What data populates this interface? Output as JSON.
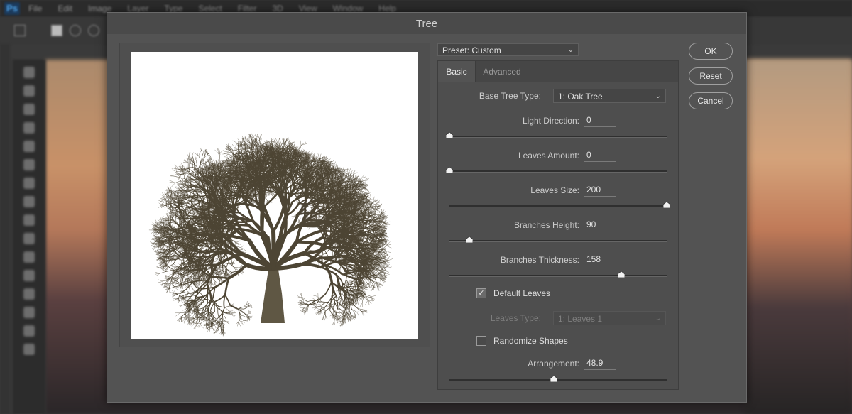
{
  "app": {
    "logo": "Ps",
    "menu": [
      "File",
      "Edit",
      "Image",
      "Layer",
      "Type",
      "Select",
      "Filter",
      "3D",
      "View",
      "Window",
      "Help"
    ]
  },
  "dialog": {
    "title": "Tree",
    "preset": "Preset: Custom",
    "tabs": [
      {
        "label": "Basic",
        "active": true
      },
      {
        "label": "Advanced",
        "active": false
      }
    ],
    "base_tree_type": {
      "label": "Base Tree Type:",
      "value": "1: Oak Tree"
    },
    "sliders": {
      "light_direction": {
        "label": "Light Direction:",
        "value": "0",
        "fraction": 0.0
      },
      "leaves_amount": {
        "label": "Leaves Amount:",
        "value": "0",
        "fraction": 0.0
      },
      "leaves_size": {
        "label": "Leaves Size:",
        "value": "200",
        "fraction": 1.0
      },
      "branches_height": {
        "label": "Branches Height:",
        "value": "90",
        "fraction": 0.09
      },
      "branches_thickness": {
        "label": "Branches Thickness:",
        "value": "158",
        "fraction": 0.79
      },
      "arrangement": {
        "label": "Arrangement:",
        "value": "48.9",
        "fraction": 0.48
      }
    },
    "default_leaves": {
      "label": "Default Leaves",
      "checked": true
    },
    "leaves_type": {
      "label": "Leaves Type:",
      "value": "1: Leaves 1",
      "disabled": true
    },
    "randomize_shapes": {
      "label": "Randomize Shapes",
      "checked": false
    },
    "buttons": {
      "ok": "OK",
      "reset": "Reset",
      "cancel": "Cancel"
    }
  },
  "icons": {
    "checkmark": "checkmark-icon",
    "chevron": "chevron-down-icon",
    "slider_knob": "slider-knob-icon"
  },
  "colors": {
    "dialog_bg": "#535353",
    "panel_bg": "#4e4e4e",
    "preview_bg": "#ffffff",
    "bark": "#4d4534"
  }
}
